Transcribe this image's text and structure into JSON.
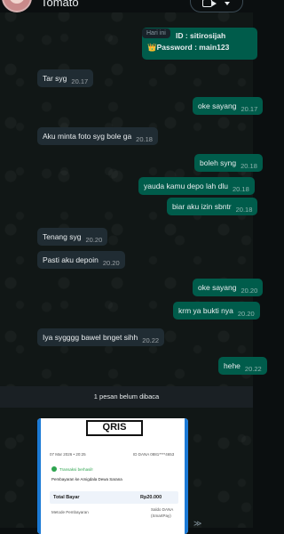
{
  "header": {
    "contact_name": "Tomato"
  },
  "badge_day": "Hari ini",
  "top_card": {
    "line1": "ID : sitirosijah",
    "line2": "👑Password :  main123"
  },
  "messages": [
    {
      "dir": "in",
      "text": "Tar syg",
      "time": "20.17"
    },
    {
      "dir": "out",
      "text": "oke sayang",
      "time": "20.17"
    },
    {
      "dir": "in",
      "text": "Aku minta foto syg bole ga",
      "time": "20.18"
    },
    {
      "dir": "out",
      "text": "boleh syng",
      "time": "20.18"
    },
    {
      "dir": "out",
      "text": "yauda kamu depo lah dlu",
      "time": "20.18"
    },
    {
      "dir": "out",
      "text": "biar aku izin sbntr",
      "time": "20.18"
    },
    {
      "dir": "in",
      "text": "Tenang syg",
      "time": "20.20"
    },
    {
      "dir": "in",
      "text": "Pasti aku depoin",
      "time": "20.20"
    },
    {
      "dir": "out",
      "text": "oke sayang",
      "time": "20.20"
    },
    {
      "dir": "out",
      "text": "krm ya bukti nya",
      "time": "20.20"
    },
    {
      "dir": "in",
      "text": "Iya sygggg bawel bnget sihh",
      "time": "20.22"
    },
    {
      "dir": "out",
      "text": "hehe",
      "time": "20.22"
    }
  ],
  "unread_banner": "1 pesan belum dibaca",
  "receipt": {
    "logo": "QRIS",
    "date": "07 Mar 2026 • 20:25",
    "id": "ID DANA 0881****4653",
    "status": "Transaksi berhasil!",
    "payment_to": "Pembayaran ke Amigdala Dewa Sarana",
    "total_label": "Total Bayar",
    "total_value": "Rp20.000",
    "method_label": "Metode Pembayaran",
    "method_value": "Saldo DANA",
    "method_sub": "(SmartPay)"
  }
}
